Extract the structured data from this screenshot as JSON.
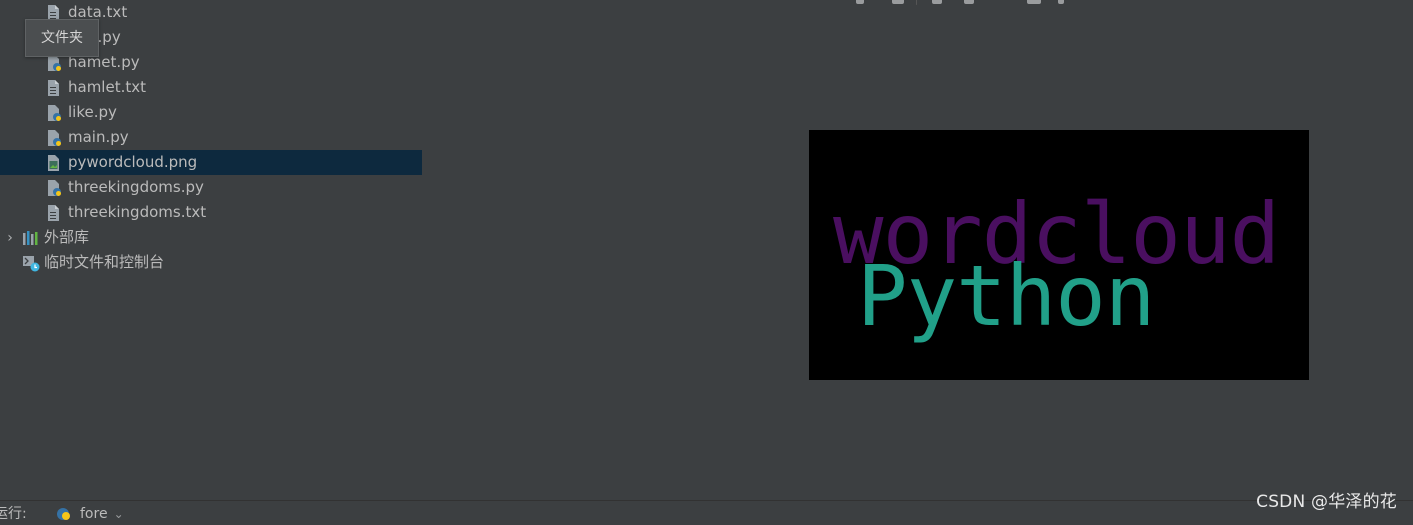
{
  "sidebar": {
    "files": [
      {
        "label": "data.txt",
        "type": "txt"
      },
      {
        "label": "fore.py",
        "type": "py"
      },
      {
        "label": "hamet.py",
        "type": "py"
      },
      {
        "label": "hamlet.txt",
        "type": "txt"
      },
      {
        "label": "like.py",
        "type": "py"
      },
      {
        "label": "main.py",
        "type": "py"
      },
      {
        "label": "pywordcloud.png",
        "type": "png",
        "selected": true
      },
      {
        "label": "threekingdoms.py",
        "type": "py"
      },
      {
        "label": "threekingdoms.txt",
        "type": "txt"
      }
    ],
    "external_libraries": "外部库",
    "scratches": "临时文件和控制台"
  },
  "tooltip": {
    "text": "文件夹"
  },
  "image_preview": {
    "background": "#000000",
    "words": [
      {
        "text": "wordcloud",
        "color": "#4a0f60"
      },
      {
        "text": "Python",
        "color": "#21a089"
      }
    ]
  },
  "bottom_bar": {
    "run_label": "运行:",
    "run_tab": "fore"
  },
  "watermark": "CSDN @华泽的花",
  "colors": {
    "background": "#3c3f41",
    "selection": "#0d293e",
    "text": "#bbbbbb"
  }
}
